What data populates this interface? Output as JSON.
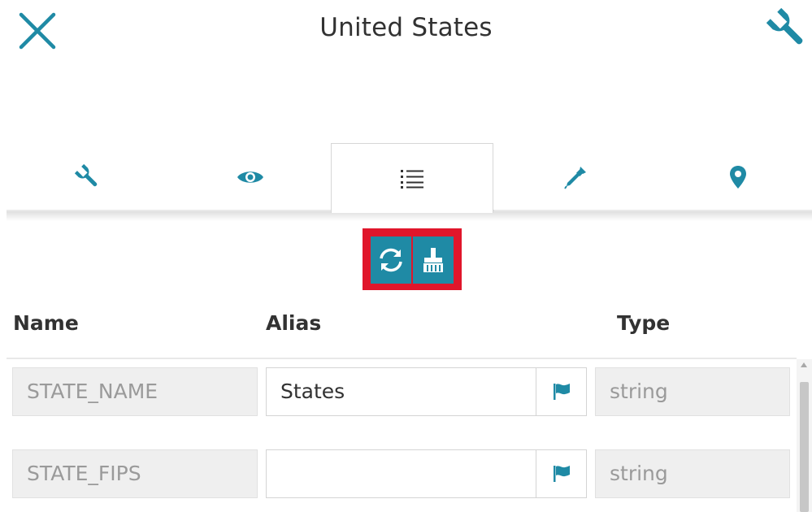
{
  "header": {
    "title": "United States",
    "close_icon": "close-icon",
    "settings_icon": "wrench-icon"
  },
  "tabs": [
    {
      "icon": "wrench-icon",
      "active": false
    },
    {
      "icon": "eye-icon",
      "active": false
    },
    {
      "icon": "list-icon",
      "active": true
    },
    {
      "icon": "eyedropper-icon",
      "active": false
    },
    {
      "icon": "map-marker-icon",
      "active": false
    }
  ],
  "actions": [
    {
      "icon": "refresh-icon"
    },
    {
      "icon": "broom-icon"
    }
  ],
  "table": {
    "columns": {
      "name": "Name",
      "alias": "Alias",
      "type": "Type"
    },
    "rows": [
      {
        "name": "STATE_NAME",
        "alias": "States",
        "type": "string",
        "flag_icon": "flag-icon"
      },
      {
        "name": "STATE_FIPS",
        "alias": "",
        "type": "string",
        "flag_icon": "flag-icon"
      }
    ]
  },
  "colors": {
    "accent": "#1f8aa5",
    "highlight_border": "#e0162b",
    "text": "#323232",
    "readonly_bg": "#efefef",
    "readonly_text": "#9a9a9a"
  }
}
